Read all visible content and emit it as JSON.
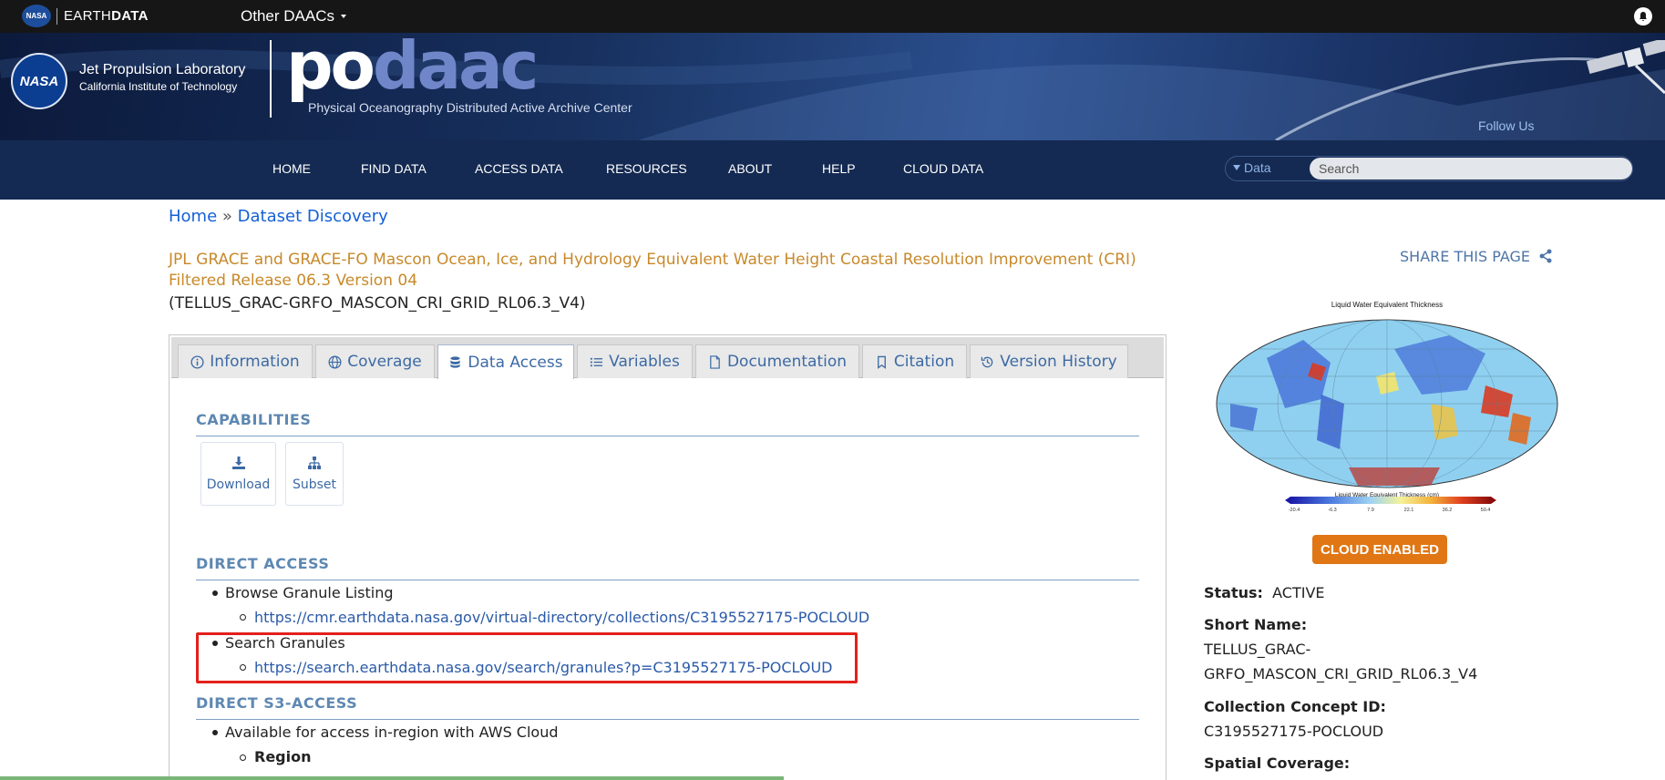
{
  "earthdata_bar": {
    "logo_text": "NASA",
    "brand_prefix": "EARTH",
    "brand_suffix": "DATA",
    "other_daacs": "Other DAACs"
  },
  "banner": {
    "nasa_logo_text": "NASA",
    "jpl_line1": "Jet Propulsion Laboratory",
    "jpl_line2": "California Institute of Technology",
    "logo_po": "po",
    "logo_daac": "daac",
    "logo_subtitle": "Physical Oceanography Distributed Active Archive Center",
    "follow_us": "Follow Us"
  },
  "nav": {
    "items": [
      "HOME",
      "FIND DATA",
      "ACCESS DATA",
      "RESOURCES",
      "ABOUT",
      "HELP",
      "CLOUD DATA"
    ],
    "search_type": "Data",
    "search_placeholder": "Search"
  },
  "breadcrumb": {
    "home": "Home",
    "separator": "»",
    "current": "Dataset Discovery"
  },
  "dataset": {
    "title": "JPL GRACE and GRACE-FO Mascon Ocean, Ice, and Hydrology Equivalent Water Height Coastal Resolution Improvement (CRI) Filtered Release 06.3 Version 04",
    "short_name_paren": "(TELLUS_GRAC-GRFO_MASCON_CRI_GRID_RL06.3_V4)"
  },
  "share": "SHARE THIS PAGE",
  "tabs": [
    {
      "label": "Information",
      "icon": "info-icon"
    },
    {
      "label": "Coverage",
      "icon": "globe-icon"
    },
    {
      "label": "Data Access",
      "icon": "database-icon",
      "active": true
    },
    {
      "label": "Variables",
      "icon": "list-icon"
    },
    {
      "label": "Documentation",
      "icon": "file-icon"
    },
    {
      "label": "Citation",
      "icon": "bookmark-icon"
    },
    {
      "label": "Version History",
      "icon": "history-icon"
    }
  ],
  "capabilities": {
    "heading": "CAPABILITIES",
    "download": "Download",
    "subset": "Subset"
  },
  "direct_access": {
    "heading": "DIRECT ACCESS",
    "browse_label": "Browse Granule Listing",
    "browse_url": "https://cmr.earthdata.nasa.gov/virtual-directory/collections/C3195527175-POCLOUD",
    "search_label": "Search Granules",
    "search_url": "https://search.earthdata.nasa.gov/search/granules?p=C3195527175-POCLOUD"
  },
  "s3_access": {
    "heading": "DIRECT S3-ACCESS",
    "item": "Available for access in-region with AWS Cloud",
    "region": "Region"
  },
  "thumbnail": {
    "title": "Liquid Water Equivalent Thickness",
    "colorbar_label": "Liquid Water Equivalent Thickness (cm)",
    "ticks": [
      "-20.4",
      "-6.3",
      "7.9",
      "22.1",
      "36.2",
      "50.4"
    ]
  },
  "sidebar": {
    "badge": "CLOUD ENABLED",
    "status_label": "Status:",
    "status_value": "ACTIVE",
    "short_name_label": "Short Name:",
    "short_name_line1": "TELLUS_GRAC-",
    "short_name_line2": "GRFO_MASCON_CRI_GRID_RL06.3_V4",
    "concept_label": "Collection Concept ID:",
    "concept_value": "C3195527175-POCLOUD",
    "spatial_label": "Spatial Coverage:"
  }
}
